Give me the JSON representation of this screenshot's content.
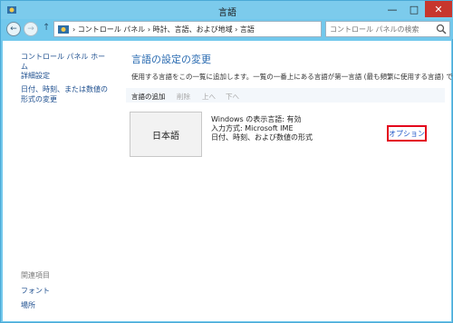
{
  "window": {
    "title": "言語"
  },
  "address": {
    "breadcrumb": [
      "コントロール パネル",
      "時計、言語、および地域",
      "言語"
    ],
    "breadcrumb_separator": "›",
    "search_placeholder": "コントロール パネルの検索"
  },
  "sidebar": {
    "home": "コントロール パネル ホーム",
    "advanced": "詳細設定",
    "datetime": "日付、時刻、または数値の形式の変更",
    "related_header": "関連項目",
    "font": "フォント",
    "location": "場所"
  },
  "main": {
    "heading": "言語の設定の変更",
    "description": "使用する言語をこの一覧に追加します。一覧の一番上にある言語が第一言語 (最も頻繁に使用する言語) です。",
    "toolbar": {
      "add": "言語の追加",
      "remove": "削除",
      "up": "上へ",
      "down": "下へ"
    },
    "language": {
      "name": "日本語",
      "display": "Windows の表示言語: 有効",
      "input": "入力方式: Microsoft IME",
      "format": "日付、時刻、および数値の形式",
      "options": "オプション"
    }
  },
  "colors": {
    "accent": "#2a6bb1",
    "link": "#1e4f8f",
    "highlight": "#e3001b",
    "titlebar": "#7ccbec",
    "close": "#c7362d"
  }
}
